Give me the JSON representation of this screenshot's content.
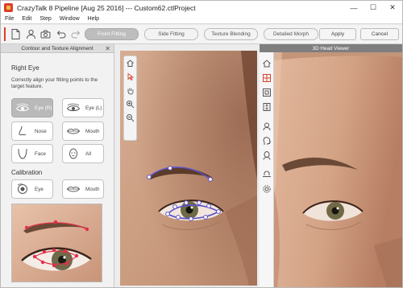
{
  "window": {
    "title": "CrazyTalk 8 Pipeline [Aug 25 2016] --- Custom62.ctlProject",
    "minimize": "—",
    "maximize": "☐",
    "close": "✕"
  },
  "menu": [
    "File",
    "Edit",
    "Step",
    "Window",
    "Help"
  ],
  "toolbar": {
    "tabs": [
      "Front Fitting",
      "Side Fitting",
      "Texture Blending",
      "Detailed Morph"
    ],
    "active_tab": "Front Fitting",
    "apply_label": "Apply",
    "cancel_label": "Cancel",
    "accent_color": "#d8402a"
  },
  "left_panel": {
    "header": "Contour and Texture Alignment",
    "close": "✕",
    "section_title": "Right Eye",
    "hint": "Correctly align your fitting points to the target feature.",
    "features": [
      {
        "label": "Eye (R)",
        "active": true
      },
      {
        "label": "Eye (L)",
        "active": false
      },
      {
        "label": "Nose",
        "active": false
      },
      {
        "label": "Mouth",
        "active": false
      },
      {
        "label": "Face",
        "active": false
      },
      {
        "label": "All",
        "active": false
      }
    ],
    "calibration_title": "Calibration",
    "calibration": [
      {
        "label": "Eye"
      },
      {
        "label": "Mouth"
      }
    ]
  },
  "viewer": {
    "title": "3D Head Viewer"
  },
  "colors": {
    "fitting_line": "#5b4fc8",
    "fitting_point": "#e0304a",
    "panel_accent": "#d8402a"
  },
  "icons": {
    "viewport_tools": [
      "home-icon",
      "select-arrow-icon",
      "pan-hand-icon",
      "zoom-in-icon",
      "zoom-out-icon"
    ],
    "viewer_tools": [
      "home-icon",
      "grid-icon",
      "frame-icon",
      "fit-icon",
      "head-front-icon",
      "head-side-icon",
      "head-back-icon",
      "hat-icon",
      "gear-icon"
    ]
  }
}
